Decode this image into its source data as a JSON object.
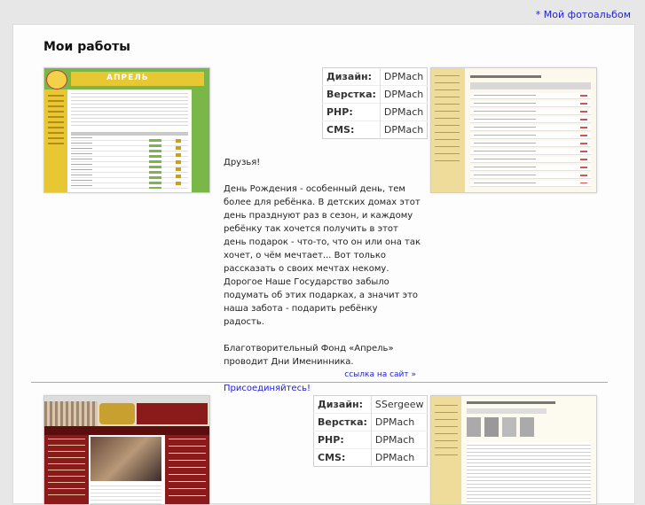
{
  "header": {
    "album_link": "* Мой фотоальбом"
  },
  "page": {
    "title": "Мои работы"
  },
  "works": [
    {
      "thumb_banner": "АПРЕЛЬ",
      "credits": [
        {
          "label": "Дизайн:",
          "value": "DPMach"
        },
        {
          "label": "Верстка:",
          "value": "DPMach"
        },
        {
          "label": "PHP:",
          "value": "DPMach"
        },
        {
          "label": "CMS:",
          "value": "DPMach"
        }
      ],
      "description": {
        "greeting": "Друзья!",
        "para1": "День Рождения - особенный день, тем более для ребёнка. В детских домах этот день празднуют раз в сезон, и каждому ребёнку так хочется получить в этот день подарок - что-то, что он или она так хочет, о чём мечтает... Вот только рассказать о своих мечтах некому. Дорогое Наше Государство забыло подумать об этих подарках, а значит это наша забота - подарить ребёнку радость.",
        "para2": "Благотворительный Фонд «Апрель» проводит Дни Именинника.",
        "join_link": "Присоединяйтесь!"
      },
      "site_link": "ссылка на сайт »"
    },
    {
      "credits": [
        {
          "label": "Дизайн:",
          "value": "SSergeew"
        },
        {
          "label": "Верстка:",
          "value": "DPMach"
        },
        {
          "label": "PHP:",
          "value": "DPMach"
        },
        {
          "label": "CMS:",
          "value": "DPMach"
        }
      ]
    }
  ],
  "colors": {
    "link": "#2222cc",
    "aprel_green": "#7ab648",
    "aprel_yellow": "#e8c832",
    "admin_beige": "#f0dc9a",
    "burgundy": "#8b1a1a"
  }
}
